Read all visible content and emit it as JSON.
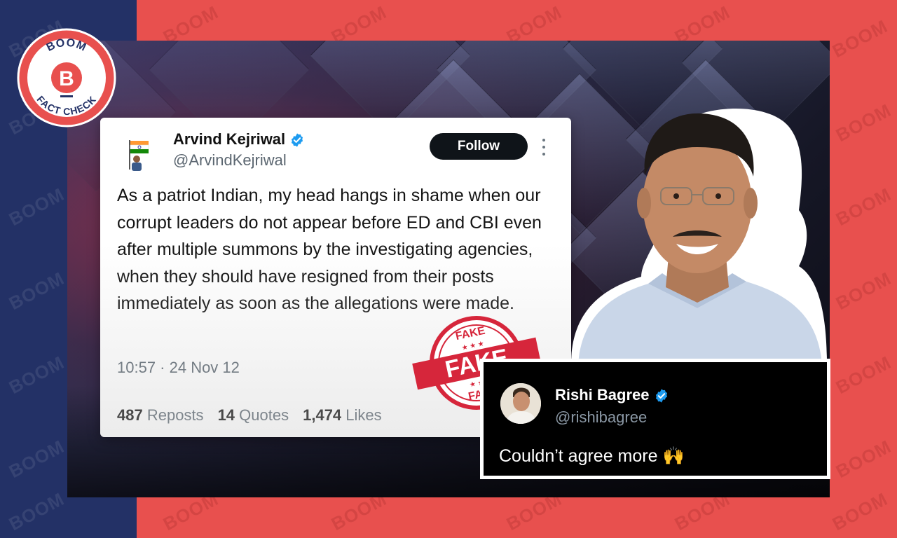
{
  "watermark_text": "BOOM",
  "logo": {
    "top_text": "BOOM",
    "bottom_text": "FACT CHECK",
    "letter": "B",
    "colors": {
      "ring": "#e8504e",
      "inner": "#ffffff",
      "badge": "#e8504e",
      "text": "#233166"
    }
  },
  "colors": {
    "left_panel": "#233166",
    "right_panel": "#e8504e",
    "verified": "#1d9bf0",
    "follow_bg": "#0f1419",
    "stamp": "#d6263b"
  },
  "tweet": {
    "name": "Arvind Kejriwal",
    "handle": "@ArvindKejriwal",
    "follow_label": "Follow",
    "text": "As a patriot Indian, my head hangs in shame when our corrupt leaders do not appear before ED and CBI even after multiple summons by the investigating agencies, when they should have resigned from their posts immediately as soon as the allegations were made.",
    "time": "10:57 · 24 Nov 12",
    "stats": {
      "reposts_count": "487",
      "reposts_label": "Reposts",
      "quotes_count": "14",
      "quotes_label": "Quotes",
      "likes_count": "1,474",
      "likes_label": "Likes"
    },
    "icons": [
      "verified-badge-icon",
      "more-options-icon"
    ]
  },
  "stamp": {
    "main": "FAKE",
    "top": "FAKE",
    "bottom": "FAKE"
  },
  "reply": {
    "name": "Rishi Bagree",
    "handle": "@rishibagree",
    "text": "Couldn’t agree more 🙌"
  }
}
